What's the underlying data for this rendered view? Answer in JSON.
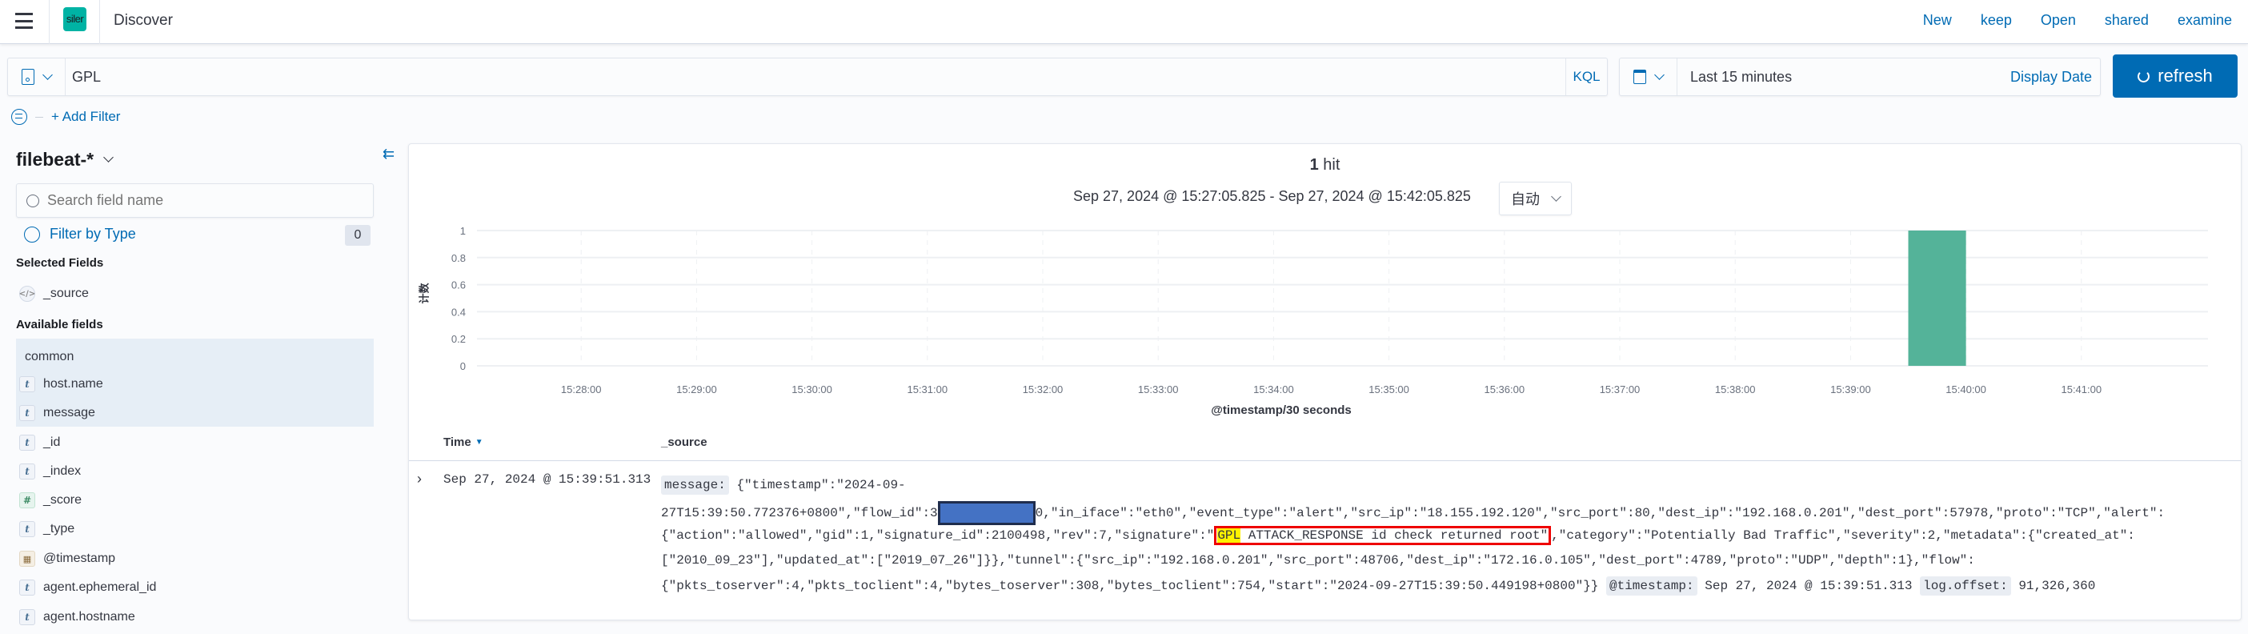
{
  "header": {
    "app_logo_text": "siler",
    "title": "Discover",
    "menu_links": [
      "New",
      "keep",
      "Open",
      "shared",
      "examine"
    ]
  },
  "query": {
    "value": "GPL",
    "language": "KQL",
    "time_range": "Last 15 minutes",
    "display_date": "Display Date",
    "refresh_label": "refresh"
  },
  "filters": {
    "add_filter": "+ Add Filter"
  },
  "sidebar": {
    "index_pattern": "filebeat-*",
    "search_placeholder": "Search field name",
    "filter_by_type": "Filter by Type",
    "filter_count": "0",
    "selected_fields_title": "Selected Fields",
    "selected_fields": [
      {
        "name": "_source",
        "type": "source"
      }
    ],
    "available_fields_title": "Available fields",
    "common_title": "common",
    "common_fields": [
      {
        "name": "host.name",
        "type": "t"
      },
      {
        "name": "message",
        "type": "t"
      }
    ],
    "available_fields": [
      {
        "name": "_id",
        "type": "t"
      },
      {
        "name": "_index",
        "type": "t"
      },
      {
        "name": "_score",
        "type": "#"
      },
      {
        "name": "_type",
        "type": "t"
      },
      {
        "name": "@timestamp",
        "type": "date"
      },
      {
        "name": "agent.ephemeral_id",
        "type": "t"
      },
      {
        "name": "agent.hostname",
        "type": "t"
      }
    ]
  },
  "results": {
    "hits_count": "1",
    "hits_label": "hit",
    "date_range": "Sep 27, 2024 @ 15:27:05.825 - Sep 27, 2024 @ 15:42:05.825",
    "interval": "自动"
  },
  "chart_data": {
    "type": "bar",
    "title": "",
    "xlabel": "@timestamp/30 seconds",
    "ylabel": "计数",
    "xlim": [
      "15:27:05.825",
      "15:42:05.825"
    ],
    "ylim": [
      0,
      1
    ],
    "yticks": [
      "0",
      "0.2",
      "0.4",
      "0.6",
      "0.8",
      "1"
    ],
    "xticks": [
      "15:28:00",
      "15:29:00",
      "15:30:00",
      "15:31:00",
      "15:32:00",
      "15:33:00",
      "15:34:00",
      "15:35:00",
      "15:36:00",
      "15:37:00",
      "15:38:00",
      "15:39:00",
      "15:40:00",
      "15:41:00"
    ],
    "bars": [
      {
        "start": "15:39:30",
        "end": "15:40:00",
        "value": 1
      }
    ],
    "bar_color": "#54b399",
    "grid": true
  },
  "table": {
    "columns": [
      "Time",
      "_source"
    ],
    "rows": [
      {
        "time": "Sep 27, 2024 @ 15:39:51.313",
        "message_label": "message:",
        "line1": "{\"timestamp\":\"2024-09-",
        "line2_before": "27T15:39:50.772376+0800\",\"flow_id\":3",
        "line2_after": "0,\"in_iface\":\"eth0\",\"event_type\":\"alert\",\"src_ip\":\"18.155.192.120\",\"src_port\":80,\"dest_ip\":\"192.168.0.201\",\"dest_port\":57978,\"proto\":\"TCP\",\"alert\":",
        "line3_before": "{\"action\":\"allowed\",\"gid\":1,\"signature_id\":2100498,\"rev\":7,\"signature\":\"",
        "line3_highlight": "GPL",
        "line3_boxed_rest": " ATTACK_RESPONSE id check returned root\"",
        "line3_after": ",\"category\":\"Potentially Bad Traffic\",\"severity\":2,\"metadata\":{\"created_at\":",
        "line4": "[\"2010_09_23\"],\"updated_at\":[\"2019_07_26\"]}},\"tunnel\":{\"src_ip\":\"192.168.0.201\",\"src_port\":48706,\"dest_ip\":\"172.16.0.105\",\"dest_port\":4789,\"proto\":\"UDP\",\"depth\":1},\"flow\":",
        "line5": "{\"pkts_toserver\":4,\"pkts_toclient\":4,\"bytes_toserver\":308,\"bytes_toclient\":754,\"start\":\"2024-09-27T15:39:50.449198+0800\"}}",
        "timestamp_label": "@timestamp:",
        "timestamp_value": "Sep 27, 2024 @ 15:39:51.313",
        "offset_label": "log.offset:",
        "offset_value": "91,326,360"
      }
    ]
  }
}
